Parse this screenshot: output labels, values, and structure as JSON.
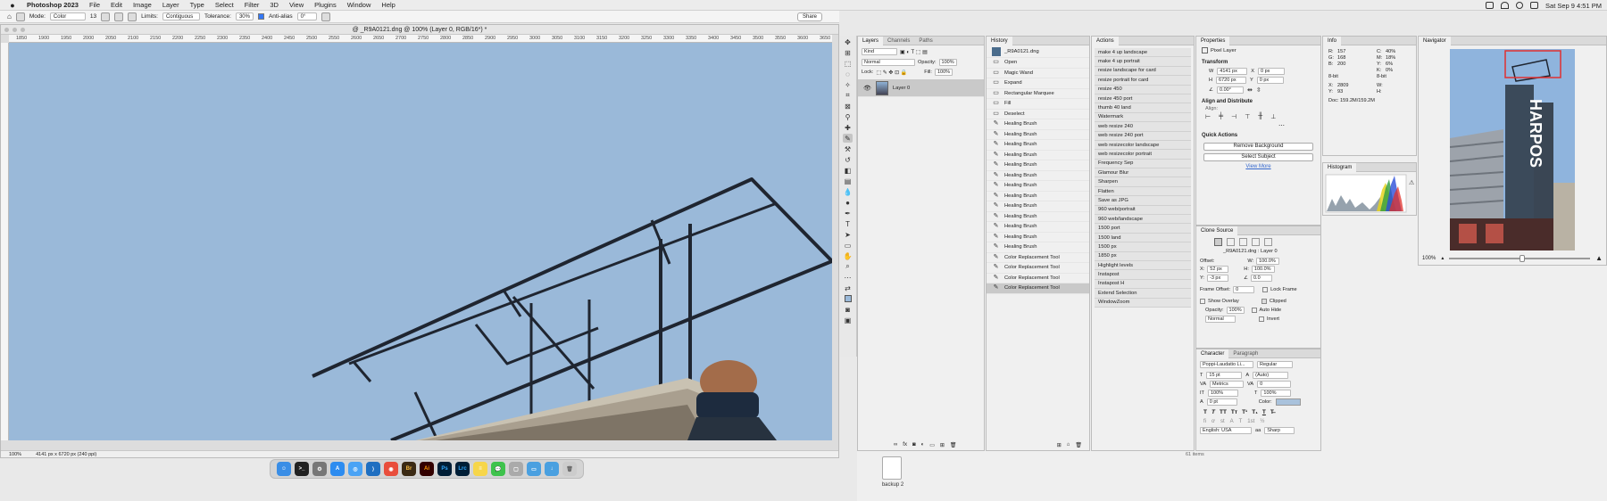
{
  "menubar": {
    "app": "Photoshop 2023",
    "items": [
      "File",
      "Edit",
      "Image",
      "Layer",
      "Type",
      "Select",
      "Filter",
      "3D",
      "View",
      "Plugins",
      "Window",
      "Help"
    ],
    "datetime": "Sat Sep 9  4:51 PM"
  },
  "options": {
    "mode_label": "Mode:",
    "mode": "Color",
    "size": "13",
    "limits_label": "Limits:",
    "limits": "Contiguous",
    "tolerance_label": "Tolerance:",
    "tolerance": "30%",
    "antialias": "Anti-alias",
    "angle": "0°",
    "share": "Share"
  },
  "document": {
    "title": "@ _R9A0121.dng @ 100% (Layer 0, RGB/16*) *",
    "ruler_ticks": [
      "1850",
      "1900",
      "1950",
      "2000",
      "2050",
      "2100",
      "2150",
      "2200",
      "2250",
      "2300",
      "2350",
      "2400",
      "2450",
      "2500",
      "2550",
      "2600",
      "2650",
      "2700",
      "2750",
      "2800",
      "2850",
      "2900",
      "2950",
      "3000",
      "3050",
      "3100",
      "3150",
      "3200",
      "3250",
      "3300",
      "3350",
      "3400",
      "3450",
      "3500",
      "3550",
      "3600",
      "3650"
    ],
    "zoom": "100%",
    "dimensions": "4141 px x 6720 px (240 ppi)"
  },
  "layers": {
    "tabs": [
      "Layers",
      "Channels",
      "Paths"
    ],
    "kind": "Kind",
    "blend": "Normal",
    "opacity_label": "Opacity:",
    "opacity": "100%",
    "lock_label": "Lock:",
    "fill_label": "Fill:",
    "fill": "100%",
    "layer_name": "Layer 0"
  },
  "history": {
    "title": "History",
    "snapshot": "_R9A0121.dng",
    "items": [
      "Open",
      "Magic Wand",
      "Expand",
      "Rectangular Marquee",
      "Fill",
      "Deselect",
      "Healing Brush",
      "Healing Brush",
      "Healing Brush",
      "Healing Brush",
      "Healing Brush",
      "Healing Brush",
      "Healing Brush",
      "Healing Brush",
      "Healing Brush",
      "Healing Brush",
      "Healing Brush",
      "Healing Brush",
      "Healing Brush",
      "Color Replacement Tool",
      "Color Replacement Tool",
      "Color Replacement Tool",
      "Color Replacement Tool"
    ]
  },
  "actions": {
    "title": "Actions",
    "items": [
      "make 4 up landscape",
      "make 4 up portrait",
      "resize landscape for card",
      "resize portrait for card",
      "resize 450",
      "resize 450 port",
      "thumb 40 land",
      "Watermark",
      "web resize 240",
      "web resize 240 port",
      "web resizecolor landscape",
      "web resizecolor portrait",
      "Frequency Sep",
      "Glamour Blur",
      "Sharpen",
      "Flatten",
      "Save as JPG",
      "960 web/portrait",
      "960 web/landscape",
      "1500 port",
      "1500 land",
      "1500 px",
      "1850 px",
      "Highlight levels",
      "Instapost",
      "Instapost H",
      "Extend Selection",
      "WindowZoom"
    ]
  },
  "properties": {
    "title": "Properties",
    "kind": "Pixel Layer",
    "transform": "Transform",
    "w_label": "W",
    "w": "4141 px",
    "x_label": "X",
    "x": "0 px",
    "h_label": "H",
    "h": "6720 px",
    "y_label": "Y",
    "y": "0 px",
    "angle": "0.00°",
    "align": "Align and Distribute",
    "align_label": "Align:",
    "quick": "Quick Actions",
    "remove_bg": "Remove Background",
    "select_subject": "Select Subject",
    "view_more": "View More"
  },
  "clone": {
    "title": "Clone Source",
    "source": "_R9A0121.dng : Layer 0",
    "offset": "Offset:",
    "x_label": "X:",
    "x": "52 px",
    "y_label": "Y:",
    "y": "-3 px",
    "w_label": "W:",
    "w": "100.0%",
    "h_label": "H:",
    "h": "100.0%",
    "angle": "0.0",
    "frame_offset": "Frame Offset:",
    "frame_value": "0",
    "lock_frame": "Lock Frame",
    "show_overlay": "Show Overlay",
    "opacity_label": "Opacity:",
    "opacity": "100%",
    "clipped": "Clipped",
    "auto_hide": "Auto Hide",
    "invert": "Invert",
    "blend": "Normal"
  },
  "character": {
    "tabs": [
      "Character",
      "Paragraph"
    ],
    "font": "Poppi-Laudatio Li...",
    "style": "Regular",
    "size": "15 pt",
    "leading": "(Auto)",
    "kerning": "Metrics",
    "tracking": "0",
    "vscale": "100%",
    "hscale": "100%",
    "baseline": "0 pt",
    "color_label": "Color:",
    "color": "#a9c2dc",
    "language": "English: USA",
    "aa": "Sharp",
    "tt": [
      "T",
      "T",
      "TT",
      "Tт",
      "T¹",
      "T₁",
      "T",
      "T̶"
    ]
  },
  "info": {
    "title": "Info",
    "r_label": "R:",
    "r": "157",
    "g_label": "G:",
    "g": "168",
    "b_label": "B:",
    "b": "200",
    "bit": "8-bit",
    "c_label": "C:",
    "c": "40%",
    "m_label": "M:",
    "m": "18%",
    "y_label": "Y:",
    "y": "6%",
    "k_label": "K:",
    "k": "0%",
    "x_label": "X:",
    "x": "2809",
    "y2_label": "Y:",
    "y2": "93",
    "w_label": "W:",
    "h_label": "H:",
    "doc": "Doc: 159.2M/159.2M"
  },
  "histogram": {
    "title": "Histogram"
  },
  "navigator": {
    "title": "Navigator",
    "zoom": "100%",
    "sign": "HARPOS"
  },
  "desktop": {
    "file": "backup 2",
    "items": "61 items"
  }
}
